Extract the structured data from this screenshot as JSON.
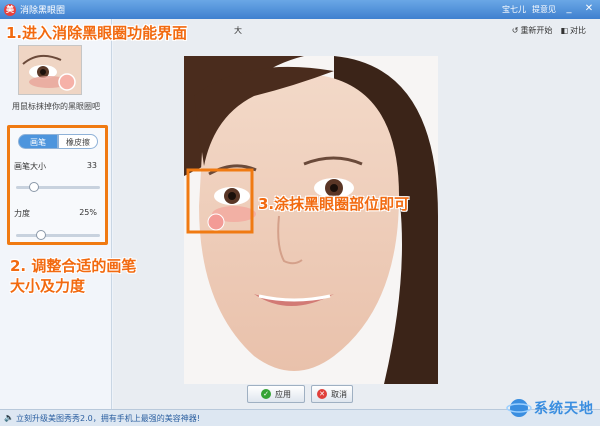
{
  "window": {
    "title": "消除黑眼圈",
    "app_icon": "美"
  },
  "titlebar": {
    "user": "宝七儿",
    "feedback": "提意见",
    "minimize": "_",
    "close": "✕"
  },
  "left_panel": {
    "thumb_hint": "用鼠标抹掉你的黑眼圈吧",
    "tabs": [
      {
        "label": "画笔"
      },
      {
        "label": "橡皮擦"
      }
    ],
    "brush_size": {
      "label": "画笔大小",
      "value": "33",
      "level": 0.18
    },
    "strength": {
      "label": "力度",
      "value": "25%",
      "level": 0.27
    }
  },
  "toolbar": {
    "label": "大",
    "reset": "重新开始",
    "compare": "对比"
  },
  "annotations": {
    "step1": "1.进入消除黑眼圈功能界面",
    "step2_line1": "2. 调整合适的画笔",
    "step2_line2": "大小及力度",
    "step3": "3.涂抹黑眼圈部位即可"
  },
  "buttons": {
    "apply": "应用",
    "cancel": "取消"
  },
  "status": {
    "text": "立刻升级美图秀秀2.0，拥有手机上最强的美容神器!"
  },
  "watermark": {
    "text": "系统天地"
  },
  "colors": {
    "accent": "#f07a12",
    "titlebar": "#3f80cf",
    "tab_active": "#4d95dd"
  }
}
